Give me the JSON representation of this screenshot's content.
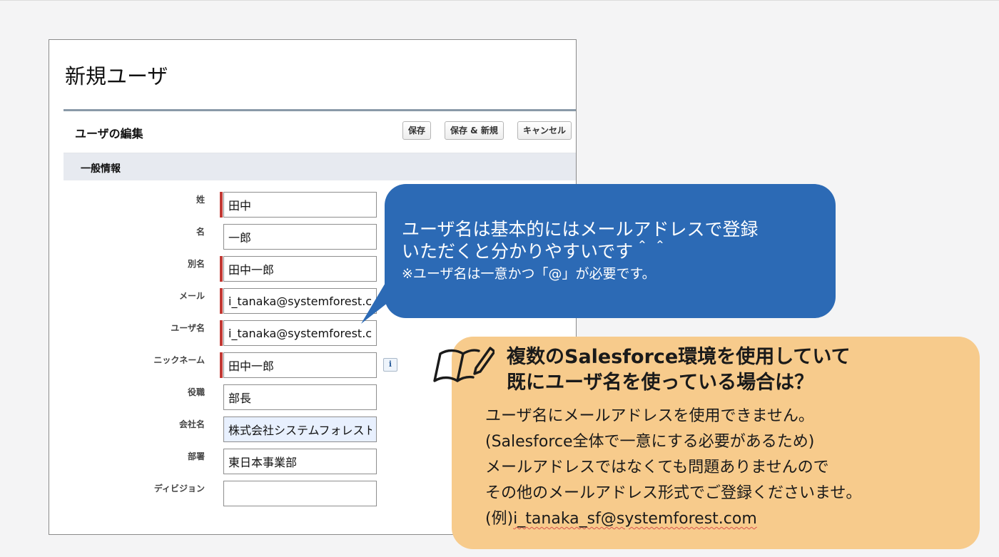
{
  "page_title": "新規ユーザ",
  "edit_block": {
    "title": "ユーザの編集",
    "buttons": {
      "save": "保存",
      "save_new": "保存 & 新規",
      "cancel": "キャンセル"
    }
  },
  "section": {
    "title": "一般情報"
  },
  "fields": {
    "last_name": {
      "label": "姓",
      "value": "田中"
    },
    "first_name": {
      "label": "名",
      "value": "一郎"
    },
    "alias": {
      "label": "別名",
      "value": "田中一郎"
    },
    "email": {
      "label": "メール",
      "value": "i_tanaka@systemforest.com"
    },
    "username": {
      "label": "ユーザ名",
      "value": "i_tanaka@systemforest.com"
    },
    "nickname": {
      "label": "ニックネーム",
      "value": "田中一郎"
    },
    "title": {
      "label": "役職",
      "value": "部長"
    },
    "company": {
      "label": "会社名",
      "value": "株式会社システムフォレスト"
    },
    "department": {
      "label": "部署",
      "value": "東日本事業部"
    },
    "division": {
      "label": "ディビジョン",
      "value": ""
    }
  },
  "info_icon_text": "i",
  "callout_blue": {
    "line1": "ユーザ名は基本的にはメールアドレスで登録",
    "line2": "いただくと分かりやすいです＾＾",
    "note": "※ユーザ名は一意かつ「@」が必要です。"
  },
  "callout_orange": {
    "heading_line1": "複数のSalesforce環境を使用していて",
    "heading_line2": "既にユーザ名を使っている場合は？",
    "body": [
      "ユーザ名にメールアドレスを使用できません。",
      "(Salesforce全体で一意にする必要があるため)",
      "メールアドレスではなくても問題ありませんので",
      "その他のメールアドレス形式でご登録くださいませ。"
    ],
    "example_prefix": "(例)",
    "example_value": "i_tanaka_sf@systemforest.com"
  },
  "colors": {
    "required_bar": "#c23934",
    "callout_blue": "#2c6ab5",
    "callout_orange": "#f7cb8c",
    "section_bg": "#e7eaf0"
  }
}
